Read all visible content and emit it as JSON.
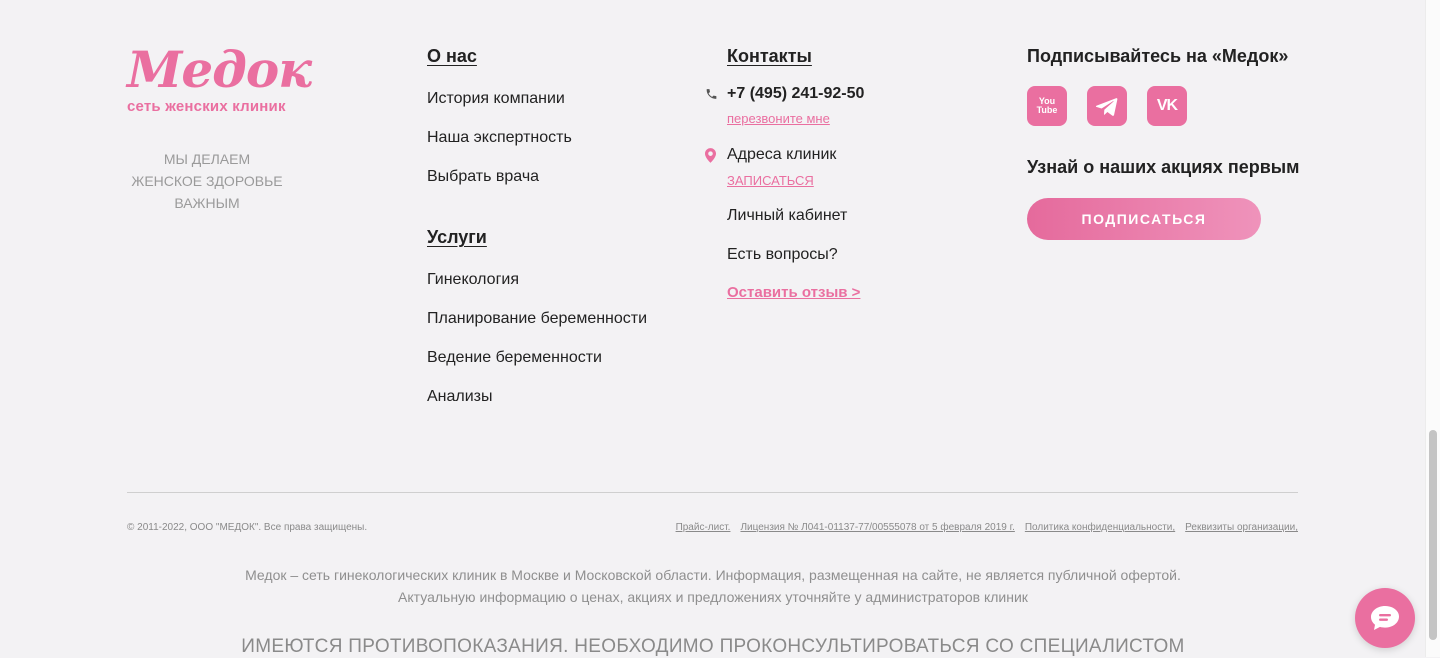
{
  "logo": {
    "word": "Медок",
    "subtitle": "сеть женских клиник"
  },
  "tagline": "МЫ ДЕЛАЕМ ЖЕНСКОЕ ЗДОРОВЬЕ ВАЖНЫМ",
  "about": {
    "title": "О нас",
    "items": [
      "История компании",
      "Наша экспертность",
      "Выбрать врача"
    ]
  },
  "services": {
    "title": "Услуги",
    "items": [
      "Гинекология",
      "Планирование беременности",
      "Ведение беременности",
      "Анализы"
    ]
  },
  "contacts": {
    "title": "Контакты",
    "phone": "+7 (495) 241-92-50",
    "callback": "перезвоните мне",
    "addresses": "Адреса клиник",
    "signup": "ЗАПИСАТЬСЯ",
    "links": [
      "Личный кабинет",
      "Есть вопросы?"
    ],
    "review": "Оставить отзыв >"
  },
  "social": {
    "title": "Подписывайтесь на «Медок»",
    "icons": [
      "youtube-icon",
      "telegram-icon",
      "vk-icon"
    ],
    "youtube_text": "You Tube",
    "vk_text": "VK",
    "promo": "Узнай о наших акциях первым",
    "subscribe": "ПОДПИСАТЬСЯ"
  },
  "footer": {
    "copyright": "© 2011-2022, ООО \"МЕДОК\". Все права защищены.",
    "links": [
      "Прайс-лист.",
      "Лицензия № Л041-01137-77/00555078 от 5 февраля 2019 г.",
      "Политика конфиденциальности,",
      "Реквизиты организации,"
    ],
    "info_line1": "Медок – сеть гинекологических клиник в Москве и Московской области. Информация, размещенная на сайте, не является публичной офертой.",
    "info_line2": "Актуальную информацию о ценах, акциях и предложениях уточняйте у администраторов клиник",
    "contraindications": "ИМЕЮТСЯ ПРОТИВОПОКАЗАНИЯ. НЕОБХОДИМО ПРОКОНСУЛЬТИРОВАТЬСЯ СО СПЕЦИАЛИСТОМ"
  },
  "colors": {
    "accent": "#ea6fa0",
    "background": "#f3f2f4",
    "text": "#222222",
    "muted": "#8f8f8f"
  }
}
